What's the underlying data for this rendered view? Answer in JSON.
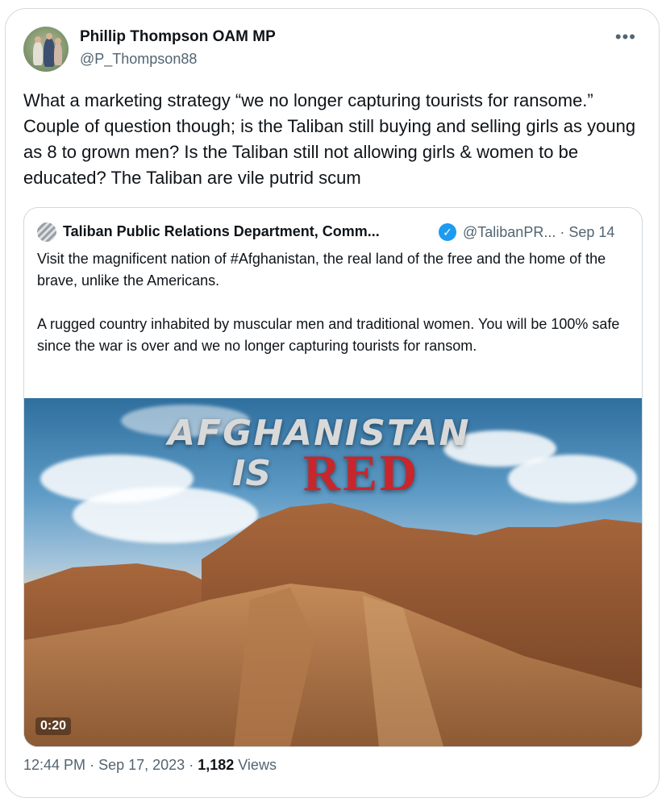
{
  "author": {
    "display_name": "Phillip Thompson OAM MP",
    "handle": "@P_Thompson88"
  },
  "more_icon": "ellipsis-icon",
  "tweet": {
    "text": "What a marketing strategy “we no longer capturing tourists for ransome.” Couple of question though; is the Taliban still buying and selling girls as young as 8 to grown men? Is the Taliban still not allowing girls & women to be educated? The Taliban are vile putrid scum"
  },
  "quote": {
    "name": "Taliban Public Relations Department, Comm...",
    "verified_icon": "verified-check-icon",
    "meta": "@TalibanPR... · Sep 14",
    "paragraph1": "Visit the magnificent nation of #Afghanistan, the real land of the free and the home of the brave, unlike the Americans.",
    "paragraph2": "A rugged country inhabited by muscular men and traditional women. You will be 100% safe since the war is over and we no longer capturing tourists for ransom.",
    "media": {
      "title_line1": "AFGHANISTAN",
      "title_is": "IS",
      "title_red": "RED",
      "duration": "0:20"
    }
  },
  "footer": {
    "time": "12:44 PM",
    "date": "Sep 17, 2023",
    "views_count": "1,182",
    "views_label": "Views"
  }
}
